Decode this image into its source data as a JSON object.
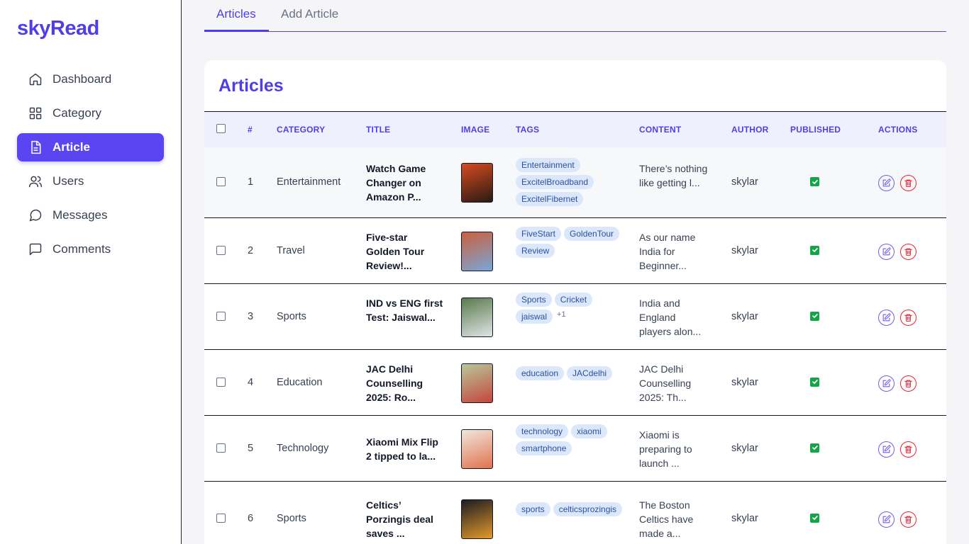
{
  "brand": "skyRead",
  "nav": [
    {
      "label": "Dashboard",
      "icon": "home-icon"
    },
    {
      "label": "Category",
      "icon": "grid-icon"
    },
    {
      "label": "Article",
      "icon": "document-icon",
      "active": true
    },
    {
      "label": "Users",
      "icon": "users-icon"
    },
    {
      "label": "Messages",
      "icon": "message-circle-icon"
    },
    {
      "label": "Comments",
      "icon": "message-square-icon"
    }
  ],
  "tabs": [
    "Articles",
    "Add Article"
  ],
  "page_title": "Articles",
  "columns": [
    "#",
    "CATEGORY",
    "TITLE",
    "IMAGE",
    "TAGS",
    "CONTENT",
    "AUTHOR",
    "PUBLISHED",
    "ACTIONS"
  ],
  "rows": [
    {
      "id": "1",
      "category": "Entertainment",
      "title": "Watch Game Changer on Amazon P...",
      "tags": [
        "Entertainment",
        "ExcitelBroadband",
        "ExcitelFibernet"
      ],
      "more": "",
      "content": "There’s nothing like getting l...",
      "author": "skylar",
      "published": true,
      "thumb_colors": [
        "#d64b1f",
        "#2a1a14"
      ]
    },
    {
      "id": "2",
      "category": "Travel",
      "title": "Five-star Golden Tour Review!...",
      "tags": [
        "FiveStart",
        "GoldenTour",
        "Review"
      ],
      "more": "",
      "content": "As our name India for Beginner...",
      "author": "skylar",
      "published": true,
      "thumb_colors": [
        "#c9603e",
        "#7aa6d8"
      ]
    },
    {
      "id": "3",
      "category": "Sports",
      "title": "IND vs ENG first Test: Jaiswal...",
      "tags": [
        "Sports",
        "Cricket",
        "jaiswal"
      ],
      "more": "+1",
      "content": "India and England players alon...",
      "author": "skylar",
      "published": true,
      "thumb_colors": [
        "#5a7a4a",
        "#dfe4e8"
      ]
    },
    {
      "id": "4",
      "category": "Education",
      "title": "JAC Delhi Counselling 2025: Ro...",
      "tags": [
        "education",
        "JACdelhi"
      ],
      "more": "",
      "content": "JAC Delhi Counselling 2025: Th...",
      "author": "skylar",
      "published": true,
      "thumb_colors": [
        "#b8c79a",
        "#c5463e"
      ]
    },
    {
      "id": "5",
      "category": "Technology",
      "title": "Xiaomi Mix Flip 2 tipped to la...",
      "tags": [
        "technology",
        "xiaomi",
        "smartphone"
      ],
      "more": "",
      "content": "Xiaomi is preparing to launch ...",
      "author": "skylar",
      "published": true,
      "thumb_colors": [
        "#f1e6dc",
        "#e0734f"
      ]
    },
    {
      "id": "6",
      "category": "Sports",
      "title": "Celtics’ Porzingis deal saves ...",
      "tags": [
        "sports",
        "celticsprozingis"
      ],
      "more": "",
      "content": "The Boston Celtics have made a...",
      "author": "skylar",
      "published": true,
      "thumb_colors": [
        "#1d1c22",
        "#e29a2b"
      ]
    }
  ]
}
